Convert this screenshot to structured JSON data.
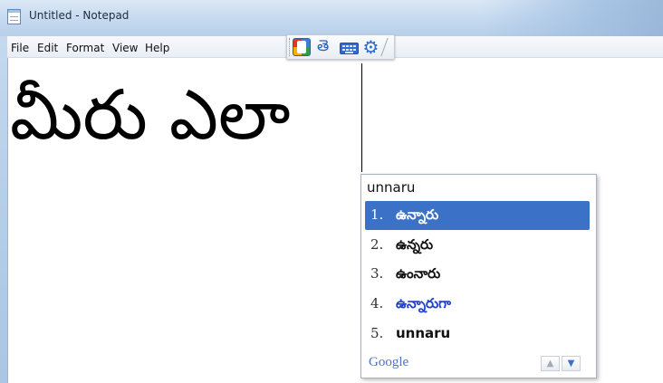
{
  "window": {
    "title": "Untitled - Notepad"
  },
  "menu": {
    "items": [
      "File",
      "Edit",
      "Format",
      "View",
      "Help"
    ]
  },
  "editor": {
    "text": "మీరు ఎలా"
  },
  "ime_toolbar": {
    "language_glyph": "తె",
    "icons": [
      "google-ime-logo-icon",
      "telugu-language-icon",
      "keyboard-icon",
      "gear-icon"
    ],
    "colors": {
      "accent": "#2f6bd1"
    }
  },
  "suggestions": {
    "input": "unnaru",
    "candidates": [
      {
        "num": "1.",
        "text": "ఉన్నారు",
        "selected": true
      },
      {
        "num": "2.",
        "text": "ఉన్నరు",
        "selected": false
      },
      {
        "num": "3.",
        "text": "ఉంనారు",
        "selected": false
      },
      {
        "num": "4.",
        "text": "ఉన్నారుగా",
        "selected": false
      },
      {
        "num": "5.",
        "text": "unnaru",
        "selected": false
      }
    ],
    "brand": "Google",
    "colors": {
      "selected": "#3b72c8",
      "alt_text": "#2040d0"
    }
  }
}
